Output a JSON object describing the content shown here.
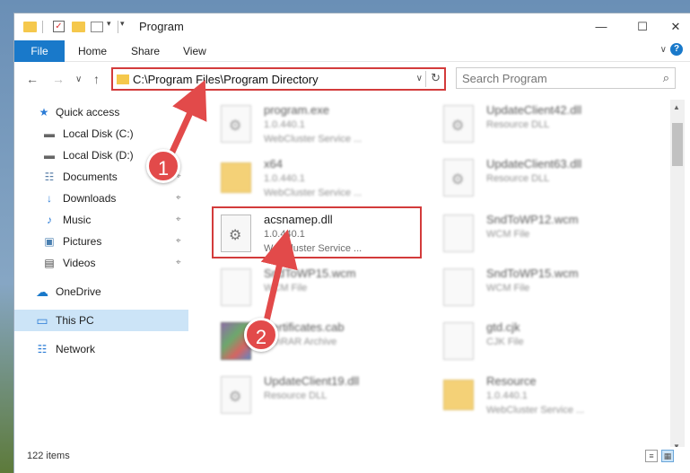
{
  "window": {
    "title": "Program",
    "minimize": "—",
    "maximize": "☐",
    "close": "✕"
  },
  "ribbon": {
    "tabs": [
      {
        "label": "File"
      },
      {
        "label": "Home"
      },
      {
        "label": "Share"
      },
      {
        "label": "View"
      }
    ],
    "expand_icon": "∨",
    "help_icon": "?"
  },
  "nav": {
    "back": "←",
    "forward": "→",
    "recent": "∨",
    "up": "↑"
  },
  "address": {
    "path": "C:\\Program Files\\Program Directory",
    "dropdown": "∨",
    "refresh": "↻"
  },
  "search": {
    "placeholder": "Search Program",
    "icon": "⌕"
  },
  "sidebar": {
    "items": [
      {
        "label": "Quick access",
        "icon": "star-icon",
        "glyph": "★",
        "pinned": false
      },
      {
        "label": "Local Disk (C:)",
        "icon": "drive-icon",
        "glyph": "▬",
        "pinned": false
      },
      {
        "label": "Local Disk (D:)",
        "icon": "drive-icon",
        "glyph": "▬",
        "pinned": false
      },
      {
        "label": "Documents",
        "icon": "documents-icon",
        "glyph": "☷",
        "pinned": true
      },
      {
        "label": "Downloads",
        "icon": "downloads-icon",
        "glyph": "↓",
        "pinned": true
      },
      {
        "label": "Music",
        "icon": "music-icon",
        "glyph": "♪",
        "pinned": true
      },
      {
        "label": "Pictures",
        "icon": "pictures-icon",
        "glyph": "▣",
        "pinned": true
      },
      {
        "label": "Videos",
        "icon": "videos-icon",
        "glyph": "▤",
        "pinned": true
      },
      {
        "label": "OneDrive",
        "icon": "cloud-icon",
        "glyph": "☁",
        "pinned": false
      },
      {
        "label": "This PC",
        "icon": "computer-icon",
        "glyph": "▭",
        "pinned": false
      },
      {
        "label": "Network",
        "icon": "network-icon",
        "glyph": "☷",
        "pinned": false
      }
    ],
    "pin_glyph": "⌖"
  },
  "files": {
    "left": [
      {
        "name": "program.exe",
        "line1": "1.0.440.1",
        "line2": "WebCluster Service ...",
        "type": "exe"
      },
      {
        "name": "x64",
        "line1": "1.0.440.1",
        "line2": "WebCluster Service ...",
        "type": "folder"
      },
      {
        "name": "acsnamep.dll",
        "line1": "1.0.440.1",
        "line2": "WebCluster Service ...",
        "type": "dll"
      },
      {
        "name": "SndToWP15.wcm",
        "line1": "WCM File",
        "line2": "",
        "type": "file"
      },
      {
        "name": "Certificates.cab",
        "line1": "WinRAR Archive",
        "line2": "",
        "type": "cab"
      },
      {
        "name": "UpdateClient19.dll",
        "line1": "Resource DLL",
        "line2": "",
        "type": "dll"
      }
    ],
    "right": [
      {
        "name": "UpdateClient42.dll",
        "line1": "Resource DLL",
        "line2": "",
        "type": "dll"
      },
      {
        "name": "UpdateClient63.dll",
        "line1": "Resource DLL",
        "line2": "",
        "type": "dll"
      },
      {
        "name": "SndToWP12.wcm",
        "line1": "WCM File",
        "line2": "",
        "type": "file"
      },
      {
        "name": "SndToWP15.wcm",
        "line1": "WCM File",
        "line2": "",
        "type": "file"
      },
      {
        "name": "gtd.cjk",
        "line1": "CJK File",
        "line2": "",
        "type": "file"
      },
      {
        "name": "Resource",
        "line1": "1.0.440.1",
        "line2": "WebCluster Service ...",
        "type": "folder"
      }
    ]
  },
  "status": {
    "item_count": "122 items"
  },
  "callouts": [
    {
      "label": "1"
    },
    {
      "label": "2"
    }
  ],
  "colors": {
    "accent": "#1979ca",
    "highlight": "#d33b3b",
    "selection": "#cce4f7"
  }
}
